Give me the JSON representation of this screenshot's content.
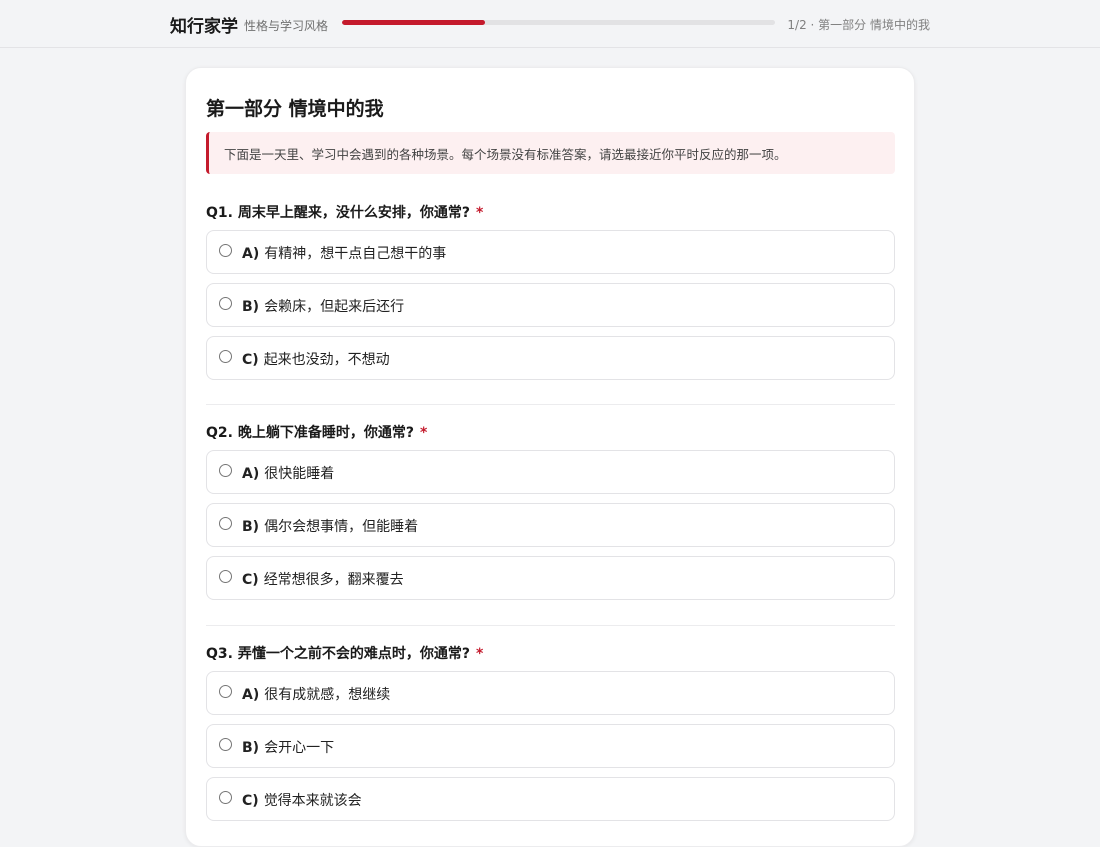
{
  "header": {
    "brand": "知行家学",
    "subtitle": "性格与学习风格",
    "progress": 0.33,
    "progress_text": "1/2 · 第一部分 情境中的我"
  },
  "section": {
    "title": "第一部分 情境中的我",
    "notice": "下面是一天里、学习中会遇到的各种场景。每个场景没有标准答案，请选最接近你平时反应的那一项。"
  },
  "questions": [
    {
      "title": "Q1. 周末早上醒来，没什么安排，你通常?",
      "required": "*",
      "options": [
        {
          "key": "A)",
          "text": "有精神，想干点自己想干的事"
        },
        {
          "key": "B)",
          "text": "会赖床，但起来后还行"
        },
        {
          "key": "C)",
          "text": "起来也没劲，不想动"
        }
      ]
    },
    {
      "title": "Q2. 晚上躺下准备睡时，你通常?",
      "required": "*",
      "options": [
        {
          "key": "A)",
          "text": "很快能睡着"
        },
        {
          "key": "B)",
          "text": "偶尔会想事情，但能睡着"
        },
        {
          "key": "C)",
          "text": "经常想很多，翻来覆去"
        }
      ]
    },
    {
      "title": "Q3. 弄懂一个之前不会的难点时，你通常?",
      "required": "*",
      "options": [
        {
          "key": "A)",
          "text": "很有成就感，想继续"
        },
        {
          "key": "B)",
          "text": "会开心一下"
        },
        {
          "key": "C)",
          "text": "觉得本来就该会"
        }
      ]
    }
  ],
  "colors": {
    "accent": "#c41a2c",
    "notice_bg": "#fdf0f1",
    "page_bg": "#f3f4f6"
  }
}
